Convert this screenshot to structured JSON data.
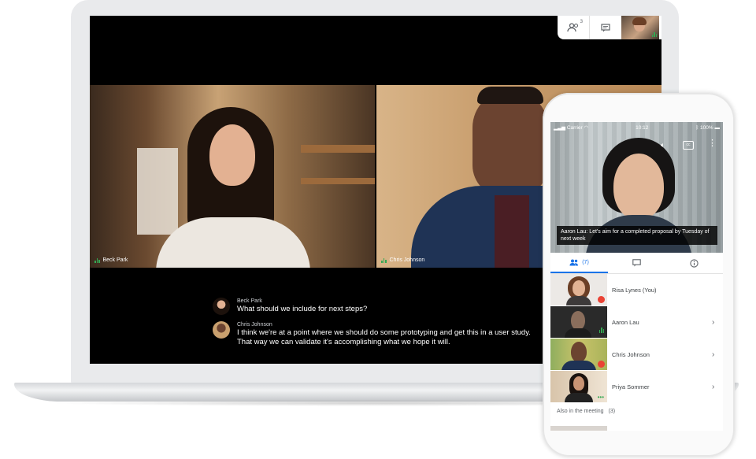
{
  "meeting": {
    "tiles": [
      {
        "name": "Beck Park"
      },
      {
        "name": "Chris Johnson"
      }
    ],
    "topbar": {
      "participants_badge": "3"
    },
    "captions": [
      {
        "speaker": "Beck Park",
        "text": "What should we include for next steps?"
      },
      {
        "speaker": "Chris Johnson",
        "text": "I think we're at a point where we should do some prototyping and get this in a user study. That way we can validate it's accomplishing what we hope it will."
      }
    ]
  },
  "phone": {
    "status": {
      "carrier": "Carrier",
      "time": "10:12",
      "battery": "100%"
    },
    "caption": "Aaron Lau: Let's aim for a completed proposal by Tuesday of next week",
    "tabs": [
      {
        "label": "(7)",
        "icon": "people-icon"
      },
      {
        "label": "",
        "icon": "chat-icon"
      },
      {
        "label": "",
        "icon": "info-icon"
      }
    ],
    "participants": [
      {
        "name": "Risa Lynes (You)",
        "muted": true
      },
      {
        "name": "Aaron Lau",
        "speaking": true
      },
      {
        "name": "Chris Johnson",
        "muted": true
      },
      {
        "name": "Priya Sommer"
      }
    ],
    "also_in_meeting": {
      "label": "Also in the meeting",
      "count": "(3)"
    }
  },
  "colors": {
    "accent": "#1a73e8",
    "speaking": "#34a853",
    "muted": "#ea4335"
  }
}
